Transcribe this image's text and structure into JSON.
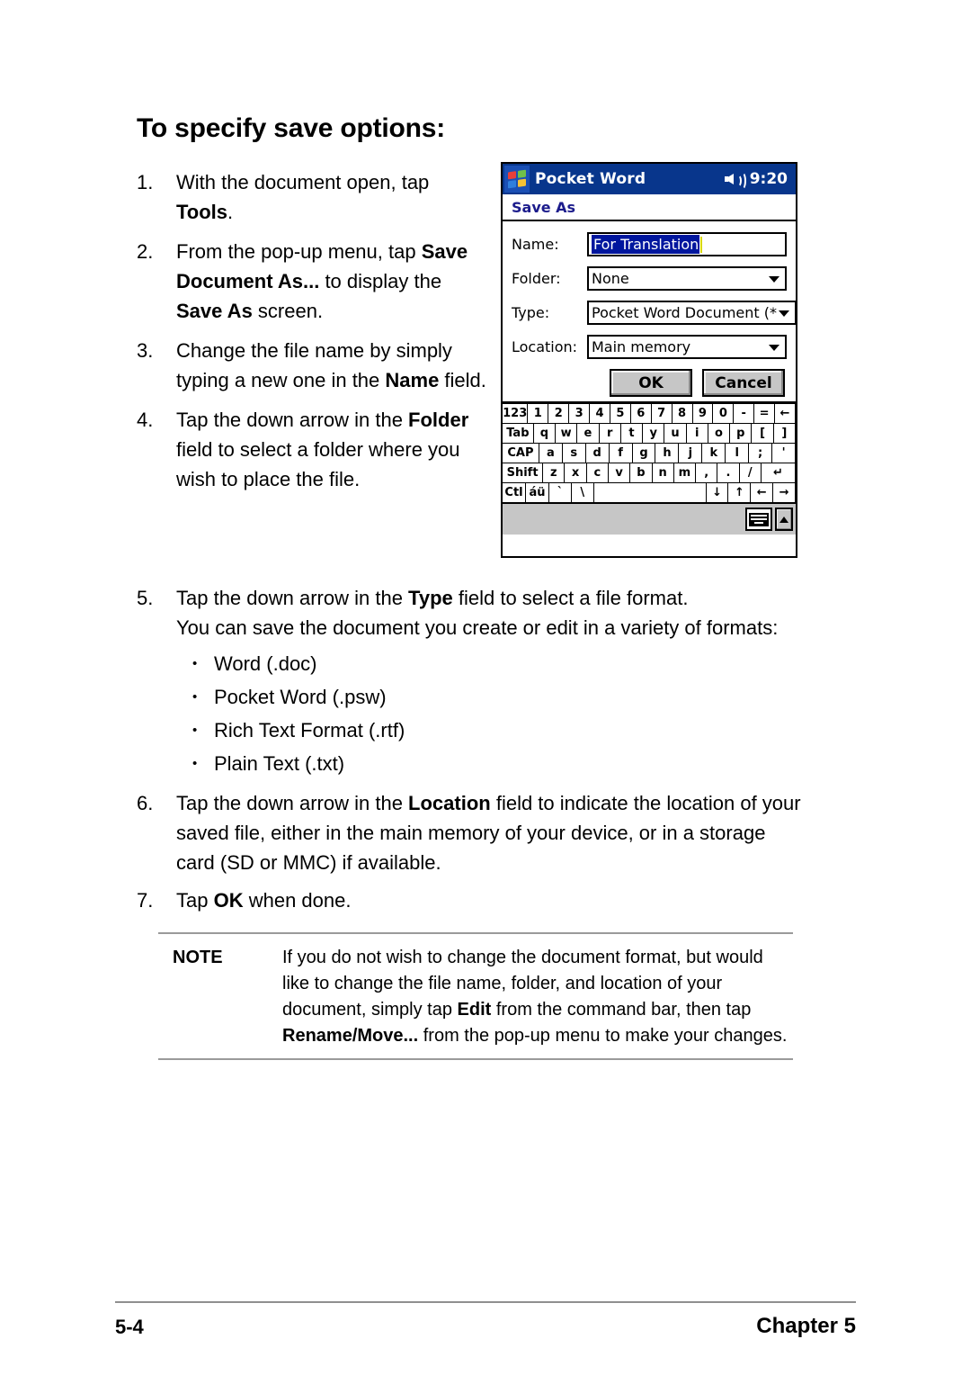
{
  "heading": "To specify save options:",
  "steps_top": [
    {
      "num": "1.",
      "html": "With the document open, tap <b>Tools</b>."
    },
    {
      "num": "2.",
      "html": "From the pop-up menu, tap <b>Save Document As...</b> to display the <b>Save As</b> screen."
    },
    {
      "num": "3.",
      "html": "Change the file name by simply typing a new one in the <b>Name</b> field."
    },
    {
      "num": "4.",
      "html": "Tap the down arrow in the <b>Folder</b> field to select a folder where you wish to place the file."
    }
  ],
  "step5": {
    "num": "5.",
    "html": "Tap the down arrow in the <b>Type</b> field to select a file format.",
    "subtext": "You can save the document you create or edit in a variety of formats:",
    "formats": [
      "Word (.doc)",
      "Pocket Word (.psw)",
      "Rich Text Format (.rtf)",
      "Plain Text (.txt)"
    ]
  },
  "step6": {
    "num": "6.",
    "html": "Tap the down arrow in the <b>Location</b> field to indicate the location of your saved file, either in the main memory of your device, or in a storage card (SD or MMC) if available."
  },
  "step7": {
    "num": "7.",
    "html": "Tap <b>OK</b> when done."
  },
  "note": {
    "label": "NOTE",
    "html": "If you do not wish to change the document format, but would like to change the file name, folder, and location of your document, simply tap <b>Edit</b> from the command bar, then tap <b>Rename/Move...</b> from the pop-up menu to make your changes."
  },
  "footer": {
    "page": "5-4",
    "chapter": "Chapter 5"
  },
  "pda": {
    "titlebar": {
      "app_title": "Pocket Word",
      "time": "9:20",
      "logo_icon": "windows-flag-icon",
      "speaker_icon": "speaker-volume-icon",
      "bg_color": "#08368c"
    },
    "subtitle": "Save As",
    "fields": [
      {
        "label": "Name:",
        "value": "For Translation",
        "control": "textbox",
        "selected": true
      },
      {
        "label": "Folder:",
        "value": "None",
        "control": "dropdown",
        "selected": false
      },
      {
        "label": "Type:",
        "value": "Pocket Word Document (*",
        "control": "dropdown",
        "selected": false
      },
      {
        "label": "Location:",
        "value": "Main memory",
        "control": "dropdown",
        "selected": false
      }
    ],
    "buttons": {
      "ok": "OK",
      "cancel": "Cancel"
    },
    "keyboard": {
      "rows": [
        [
          "123",
          "1",
          "2",
          "3",
          "4",
          "5",
          "6",
          "7",
          "8",
          "9",
          "0",
          "-",
          "=",
          "←"
        ],
        [
          "Tab",
          "q",
          "w",
          "e",
          "r",
          "t",
          "y",
          "u",
          "i",
          "o",
          "p",
          "[",
          "]"
        ],
        [
          "CAP",
          "a",
          "s",
          "d",
          "f",
          "g",
          "h",
          "j",
          "k",
          "l",
          ";",
          "'"
        ],
        [
          "Shift",
          "z",
          "x",
          "c",
          "v",
          "b",
          "n",
          "m",
          ",",
          ".",
          "/",
          "↵"
        ],
        [
          "Ctl",
          "áü",
          "`",
          "\\",
          "",
          "↓",
          "↑",
          "←",
          "→"
        ]
      ]
    },
    "cmdbar": {
      "keyboard_icon": "soft-keyboard-icon",
      "up_icon": "chevron-up-icon"
    }
  }
}
